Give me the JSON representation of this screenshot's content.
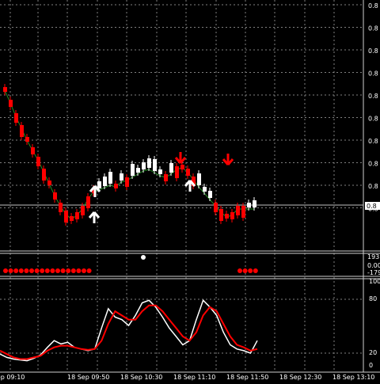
{
  "app": {
    "background": "#000000",
    "grid_color": "#7f7f7f",
    "separator_color": "#d0d0d0",
    "bull_color": "#ffffff",
    "bear_color": "#ff0000",
    "ma_color": "#228b22",
    "signal_color": "#ff0000"
  },
  "price_panel": {
    "axis_labels": [
      "0.8",
      "0.8",
      "0.8",
      "0.8",
      "0.8",
      "0.8",
      "0.8",
      "0.8",
      "0.8",
      "0.8"
    ],
    "current_price_label": "0.8"
  },
  "indicator_panel": {
    "axis_labels": [
      "193",
      "0.00",
      "-179"
    ],
    "dots": {
      "left_count": 17,
      "right_count": 4,
      "white_count": 1
    }
  },
  "oscillator_panel": {
    "axis_labels": [
      "100",
      "80",
      "20",
      "0"
    ]
  },
  "time_axis": {
    "labels": [
      "18 Sep 09:10",
      "18 Sep 09:50",
      "18 Sep 10:30",
      "18 Sep 11:10",
      "18 Sep 11:50",
      "18 Sep 12:30",
      "18 Sep 13:10"
    ]
  },
  "chart_data": {
    "type": "line",
    "title": "",
    "x": [
      "18 Sep 09:10",
      "18 Sep 09:50",
      "18 Sep 10:30",
      "18 Sep 11:10",
      "18 Sep 11:50",
      "18 Sep 12:30",
      "18 Sep 13:10"
    ],
    "candles_direction": [
      "bear",
      "bear",
      "bear",
      "bear",
      "bear",
      "bear",
      "bear",
      "bear",
      "bear",
      "bear",
      "bear",
      "bear",
      "bear",
      "bear",
      "bear",
      "bear",
      "bear",
      "bull",
      "bull",
      "bull",
      "bear",
      "bull",
      "bear",
      "bull",
      "bull",
      "bull",
      "bull",
      "bull",
      "bull",
      "bear",
      "bull",
      "bear",
      "bear",
      "bear",
      "bear",
      "bull",
      "bull",
      "bull",
      "bear",
      "bear",
      "bear",
      "bear",
      "bear",
      "bear",
      "bull",
      "bull"
    ],
    "oscillator": {
      "series": [
        {
          "values": [
            14,
            10,
            8,
            7,
            6,
            9,
            13,
            22,
            30,
            26,
            28,
            22,
            20,
            18,
            20,
            45,
            68,
            58,
            55,
            48,
            60,
            75,
            78,
            70,
            58,
            45,
            35,
            25,
            30,
            55,
            78,
            70,
            60,
            40,
            25,
            20,
            18,
            15,
            30
          ]
        },
        {
          "values": [
            18,
            14,
            10,
            8,
            8,
            10,
            12,
            18,
            22,
            24,
            24,
            22,
            20,
            19,
            20,
            30,
            50,
            65,
            60,
            55,
            55,
            65,
            72,
            72,
            65,
            55,
            45,
            35,
            30,
            40,
            60,
            70,
            65,
            50,
            35,
            25,
            22,
            18,
            20
          ]
        }
      ],
      "ylim": [
        0,
        100
      ],
      "levels": [
        20,
        80
      ]
    },
    "arrows_up": 3,
    "arrows_down": 2
  }
}
